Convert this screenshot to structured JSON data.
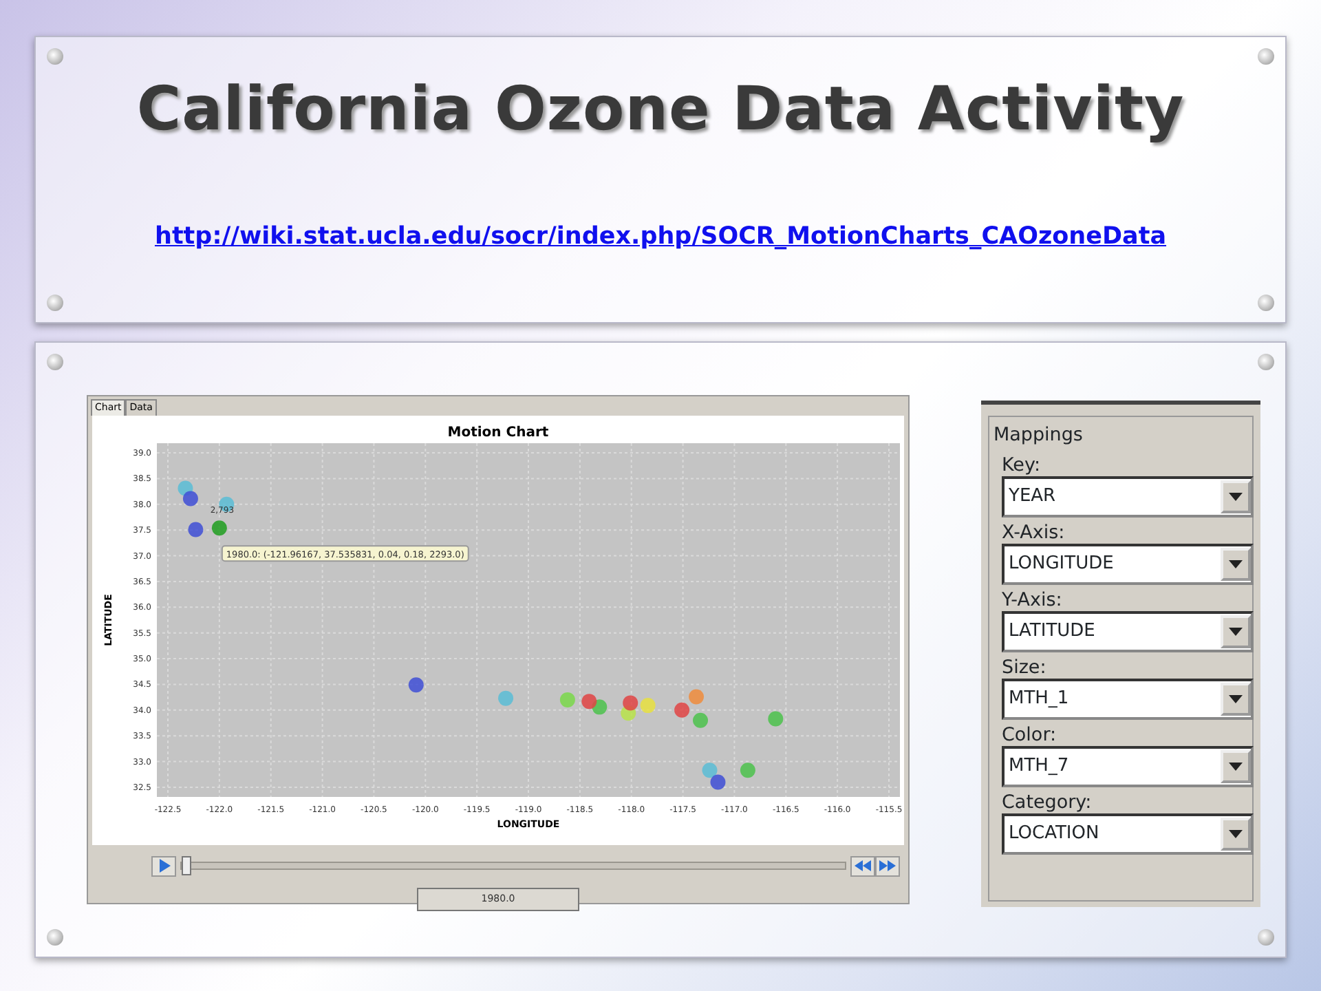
{
  "slide": {
    "title": "California Ozone Data Activity",
    "link": "http://wiki.stat.ucla.edu/socr/index.php/SOCR_MotionCharts_CAOzoneData"
  },
  "app": {
    "tabs": [
      {
        "label": "Chart",
        "selected": true
      },
      {
        "label": "Data",
        "selected": false
      }
    ],
    "chart_data": {
      "type": "scatter",
      "title": "Motion Chart",
      "xlabel": "LONGITUDE",
      "ylabel": "LATITUDE",
      "xlim": [
        -122.5,
        -115.5
      ],
      "ylim": [
        32.5,
        39.0
      ],
      "xticks": [
        {
          "value": -122.5,
          "label": "-122.5"
        },
        {
          "value": -122.0,
          "label": "-122.0"
        },
        {
          "value": -121.5,
          "label": "-121.5"
        },
        {
          "value": -121.0,
          "label": "-121.0"
        },
        {
          "value": -120.5,
          "label": "-120.5"
        },
        {
          "value": -120.0,
          "label": "-120.0"
        },
        {
          "value": -119.5,
          "label": "-119.5"
        },
        {
          "value": -119.0,
          "label": "-119.0"
        },
        {
          "value": -118.5,
          "label": "-118.5"
        },
        {
          "value": -118.0,
          "label": "-118.0"
        },
        {
          "value": -117.5,
          "label": "-117.5"
        },
        {
          "value": -117.0,
          "label": "-117.0"
        },
        {
          "value": -116.5,
          "label": "-116.5"
        },
        {
          "value": -116.0,
          "label": "-116.0"
        },
        {
          "value": -115.5,
          "label": "-115.5"
        }
      ],
      "yticks": [
        {
          "value": 32.5,
          "label": "32.5"
        },
        {
          "value": 33.0,
          "label": "33.0"
        },
        {
          "value": 33.5,
          "label": "33.5"
        },
        {
          "value": 34.0,
          "label": "34.0"
        },
        {
          "value": 34.5,
          "label": "34.5"
        },
        {
          "value": 35.0,
          "label": "35.0"
        },
        {
          "value": 35.5,
          "label": "35.5"
        },
        {
          "value": 36.0,
          "label": "36.0"
        },
        {
          "value": 36.5,
          "label": "36.5"
        },
        {
          "value": 37.0,
          "label": "37.0"
        },
        {
          "value": 37.5,
          "label": "37.5"
        },
        {
          "value": 38.0,
          "label": "38.0"
        },
        {
          "value": 38.5,
          "label": "38.5"
        },
        {
          "value": 39.0,
          "label": "39.0"
        }
      ],
      "series": [
        {
          "color": "#5bbdd6",
          "x": [
            -122.33,
            -121.93,
            -119.22,
            -117.24
          ],
          "values": [
            38.31,
            38.0,
            34.23,
            32.83
          ]
        },
        {
          "color": "#3f4fd6",
          "x": [
            -122.28,
            -122.23,
            -120.09,
            -117.16
          ],
          "values": [
            38.11,
            37.51,
            34.49,
            32.6
          ]
        },
        {
          "color": "#1e9e1e",
          "x": [
            -122.0
          ],
          "values": [
            37.54
          ]
        },
        {
          "color": "#4cc24c",
          "x": [
            -118.31,
            -117.33,
            -116.6,
            -116.87
          ],
          "values": [
            34.06,
            33.8,
            33.83,
            32.83
          ]
        },
        {
          "color": "#7ad84a",
          "x": [
            -118.62
          ],
          "values": [
            34.2
          ]
        },
        {
          "color": "#b9e34a",
          "x": [
            -118.03
          ],
          "values": [
            33.94
          ]
        },
        {
          "color": "#e04444",
          "x": [
            -118.41,
            -118.01,
            -117.51
          ],
          "values": [
            34.17,
            34.14,
            34.0
          ]
        },
        {
          "color": "#e8e040",
          "x": [
            -117.84
          ],
          "values": [
            34.09
          ]
        },
        {
          "color": "#f08c3c",
          "x": [
            -117.37
          ],
          "values": [
            34.26
          ]
        }
      ],
      "grid": true,
      "annotations": [
        {
          "text": "2,793",
          "x": -122.0,
          "y": 37.54
        },
        {
          "text": "1980.0: (-121.96167, 37.535831, 0.04, 0.18, 2293.0)",
          "x": -122.0,
          "y": 37.54
        }
      ]
    },
    "player": {
      "level": 0,
      "time": "1980.0"
    }
  },
  "mappings": {
    "title": "Mappings",
    "fields": [
      {
        "label": "Key:",
        "value": "YEAR"
      },
      {
        "label": "X-Axis:",
        "value": "LONGITUDE"
      },
      {
        "label": "Y-Axis:",
        "value": "LATITUDE"
      },
      {
        "label": "Size:",
        "value": "MTH_1"
      },
      {
        "label": "Color:",
        "value": "MTH_7"
      },
      {
        "label": "Category:",
        "value": "LOCATION"
      }
    ]
  }
}
